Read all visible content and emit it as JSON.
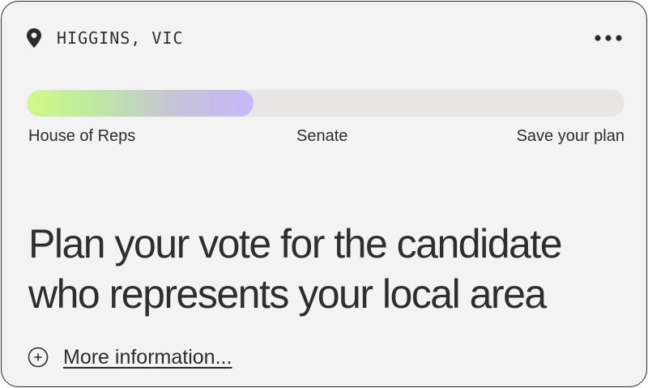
{
  "header": {
    "location": "HIGGINS, VIC",
    "location_icon": "map-pin-icon",
    "menu_icon": "more-horizontal-icon"
  },
  "progress": {
    "value_fraction": 0.38,
    "gradient_start": "#d2f986",
    "gradient_end": "#c7b8fb",
    "steps": [
      {
        "label": "House of Reps"
      },
      {
        "label": "Senate"
      },
      {
        "label": "Save your plan"
      }
    ]
  },
  "main": {
    "headline": "Plan your vote for the candidate who represents your local area"
  },
  "more_info": {
    "label": "More information...",
    "icon": "plus-circle-icon"
  }
}
